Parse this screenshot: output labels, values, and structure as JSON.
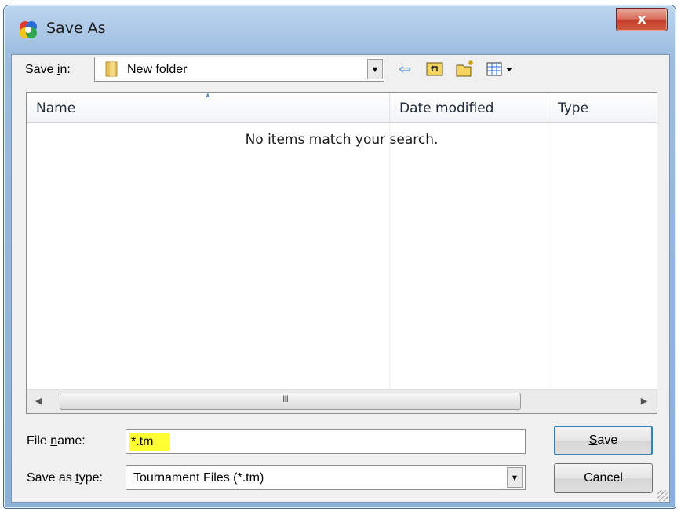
{
  "window": {
    "title": "Save As",
    "close_label": "x"
  },
  "toolbar": {
    "save_in_label_pre": "Save ",
    "save_in_label_key": "i",
    "save_in_label_post": "n:",
    "save_in_value": "New folder",
    "icons": [
      "back-arrow-icon",
      "up-folder-icon",
      "new-folder-icon",
      "view-menu-icon"
    ]
  },
  "list": {
    "columns": [
      "Name",
      "Date modified",
      "Type"
    ],
    "empty_message": "No items match your search."
  },
  "scrollbar": {
    "grip": "III"
  },
  "fields": {
    "file_name_label_pre": "File ",
    "file_name_label_key": "n",
    "file_name_label_post": "ame:",
    "file_name_value": "*.tm",
    "save_type_label_pre": "Save as ",
    "save_type_label_key": "t",
    "save_type_label_post": "ype:",
    "save_type_value": "Tournament Files (*.tm)"
  },
  "buttons": {
    "save_key": "S",
    "save_rest": "ave",
    "cancel": "Cancel"
  },
  "colors": {
    "highlight": "#ffff33",
    "titlebar": "#a9c6e6",
    "close": "#c2412a"
  }
}
